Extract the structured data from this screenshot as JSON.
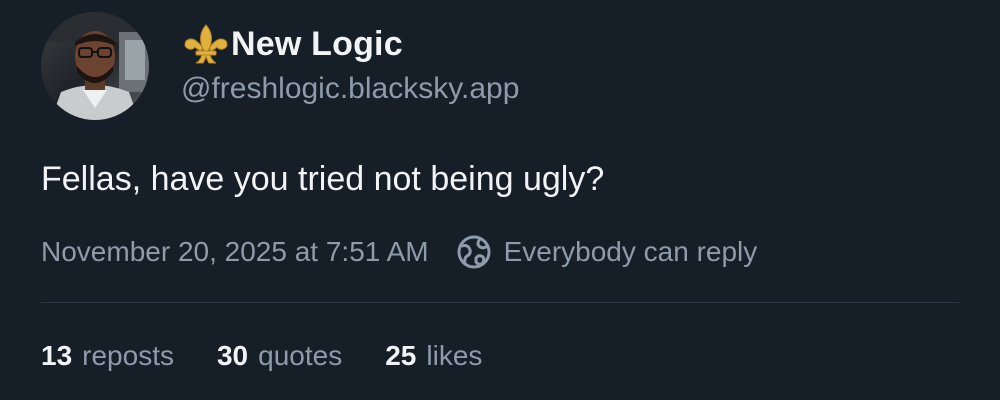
{
  "author": {
    "display_name": "New Logic",
    "handle": "@freshlogic.blacksky.app",
    "badge_icon": "fleur-de-lis-icon",
    "avatar": "profile-photo"
  },
  "post": {
    "text": "Fellas, have you tried not being ugly?",
    "timestamp": "November 20, 2025 at 7:51 AM",
    "reply_setting_icon": "globe-icon",
    "reply_setting": "Everybody can reply"
  },
  "stats": {
    "reposts": {
      "count": "13",
      "label": "reposts"
    },
    "quotes": {
      "count": "30",
      "label": "quotes"
    },
    "likes": {
      "count": "25",
      "label": "likes"
    }
  },
  "colors": {
    "background": "#161e27",
    "primary_text": "#f1f3f5",
    "secondary_text": "#8d9bab",
    "divider": "#2a3642",
    "badge_gold": "#e0b13c"
  }
}
